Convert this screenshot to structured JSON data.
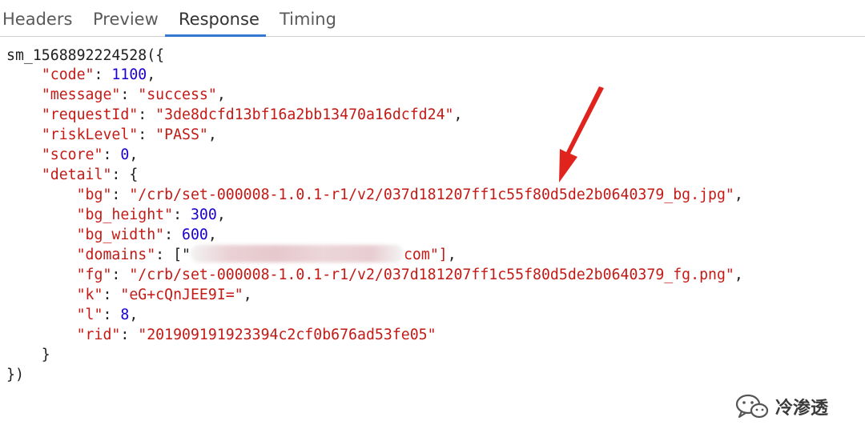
{
  "tabs": [
    {
      "label": "Headers"
    },
    {
      "label": "Preview"
    },
    {
      "label": "Response",
      "active": true
    },
    {
      "label": "Timing"
    }
  ],
  "response": {
    "callback": "sm_1568892224528",
    "code_key": "\"code\"",
    "code_val": "1100",
    "message_key": "\"message\"",
    "message_val": "\"success\"",
    "requestId_key": "\"requestId\"",
    "requestId_val": "\"3de8dcfd13bf16a2bb13470a16dcfd24\"",
    "riskLevel_key": "\"riskLevel\"",
    "riskLevel_val": "\"PASS\"",
    "score_key": "\"score\"",
    "score_val": "0",
    "detail_key": "\"detail\"",
    "bg_key": "\"bg\"",
    "bg_val": "\"/crb/set-000008-1.0.1-r1/v2/037d181207ff1c55f80d5de2b0640379_bg.jpg\"",
    "bg_height_key": "\"bg_height\"",
    "bg_height_val": "300",
    "bg_width_key": "\"bg_width\"",
    "bg_width_val": "600",
    "domains_key": "\"domains\"",
    "domains_open": "[\"",
    "domains_tail": "com\"]",
    "fg_key": "\"fg\"",
    "fg_val": "\"/crb/set-000008-1.0.1-r1/v2/037d181207ff1c55f80d5de2b0640379_fg.png\"",
    "k_key": "\"k\"",
    "k_val": "\"eG+cQnJEE9I=\"",
    "l_key": "\"l\"",
    "l_val": "8",
    "rid_key": "\"rid\"",
    "rid_val": "\"201909191923394c2cf0b676ad53fe05\""
  },
  "watermark": {
    "text": "冷渗透",
    "icon": "wechat-icon"
  },
  "colors": {
    "string": "#c41a16",
    "number": "#1c00cf",
    "accent": "#3478d4",
    "arrow": "#e0231c"
  }
}
